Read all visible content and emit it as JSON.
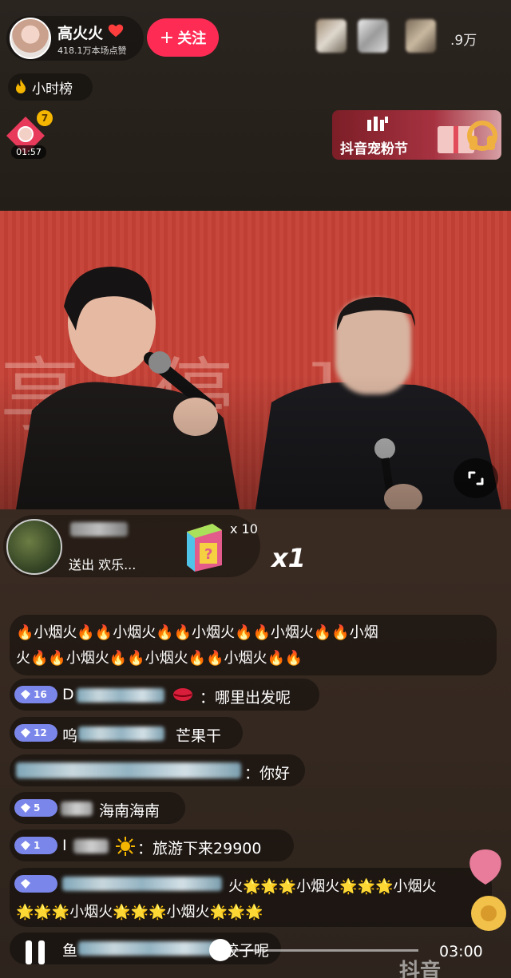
{
  "host": {
    "name": "高火火",
    "likes": "418.1万本场点赞",
    "follow_label": "关注"
  },
  "viewers": {
    "count": ".9万"
  },
  "rank": {
    "label": "小时榜"
  },
  "red_packet": {
    "badge": "7",
    "timer": "01:57"
  },
  "festival": {
    "label": "抖音宠粉节"
  },
  "gift_notice": {
    "text": "送出 欢乐...",
    "count": "x 10",
    "combo": "x1"
  },
  "chat": [
    {
      "line1": "🔥小烟火🔥🔥小烟火🔥🔥小烟火🔥🔥小烟火🔥🔥小烟",
      "line2": "火🔥🔥小烟火🔥🔥小烟火🔥🔥小烟火🔥🔥"
    },
    {
      "level": "16",
      "user_visible": "D",
      "text": "哪里出发呢"
    },
    {
      "level": "12",
      "user_visible": "呜",
      "text": "芒果干"
    },
    {
      "text": "你好"
    },
    {
      "level": "5",
      "text": "海南海南"
    },
    {
      "level": "1",
      "user_visible": "I",
      "text": "旅游下来29900"
    },
    {
      "line1_tail": "火🌟🌟🌟小烟火🌟🌟🌟小烟火",
      "line2": "🌟🌟🌟小烟火🌟🌟🌟小烟火🌟🌟🌟"
    },
    {
      "user_visible": "鱼",
      "text": "饺子呢"
    }
  ],
  "player": {
    "time": "03:00",
    "progress": 0.44
  },
  "watermark": "抖音",
  "colors": {
    "accent": "#fe2c55",
    "badge": "#7b86ea"
  }
}
